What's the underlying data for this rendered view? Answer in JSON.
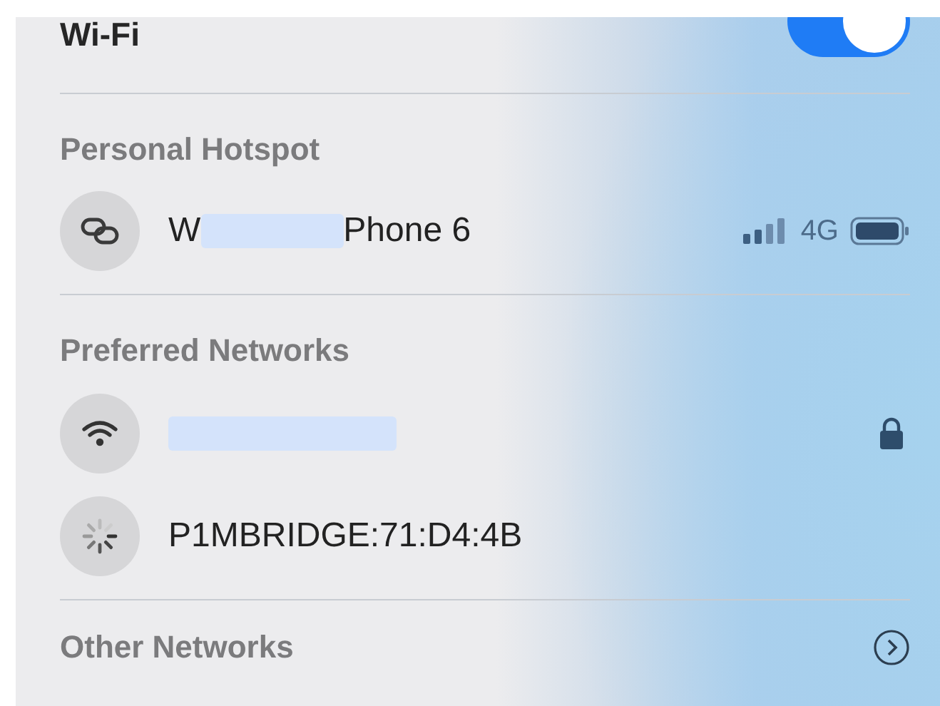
{
  "header": {
    "title": "Wi-Fi",
    "on": true
  },
  "sections": [
    {
      "title": "Personal Hotspot",
      "networks": [
        {
          "kind": "link",
          "name_start": "W",
          "redacted": true,
          "name_end": "Phone 6",
          "cellular": "4G",
          "locked": false
        }
      ]
    },
    {
      "title": "Preferred Networks",
      "networks": [
        {
          "kind": "wifi",
          "redacted": true,
          "locked": true
        },
        {
          "kind": "spinner",
          "name_start": "P1MBRIDGE:71:D4:4B",
          "redacted": false,
          "locked": false
        }
      ]
    }
  ],
  "other": {
    "title": "Other Networks"
  }
}
